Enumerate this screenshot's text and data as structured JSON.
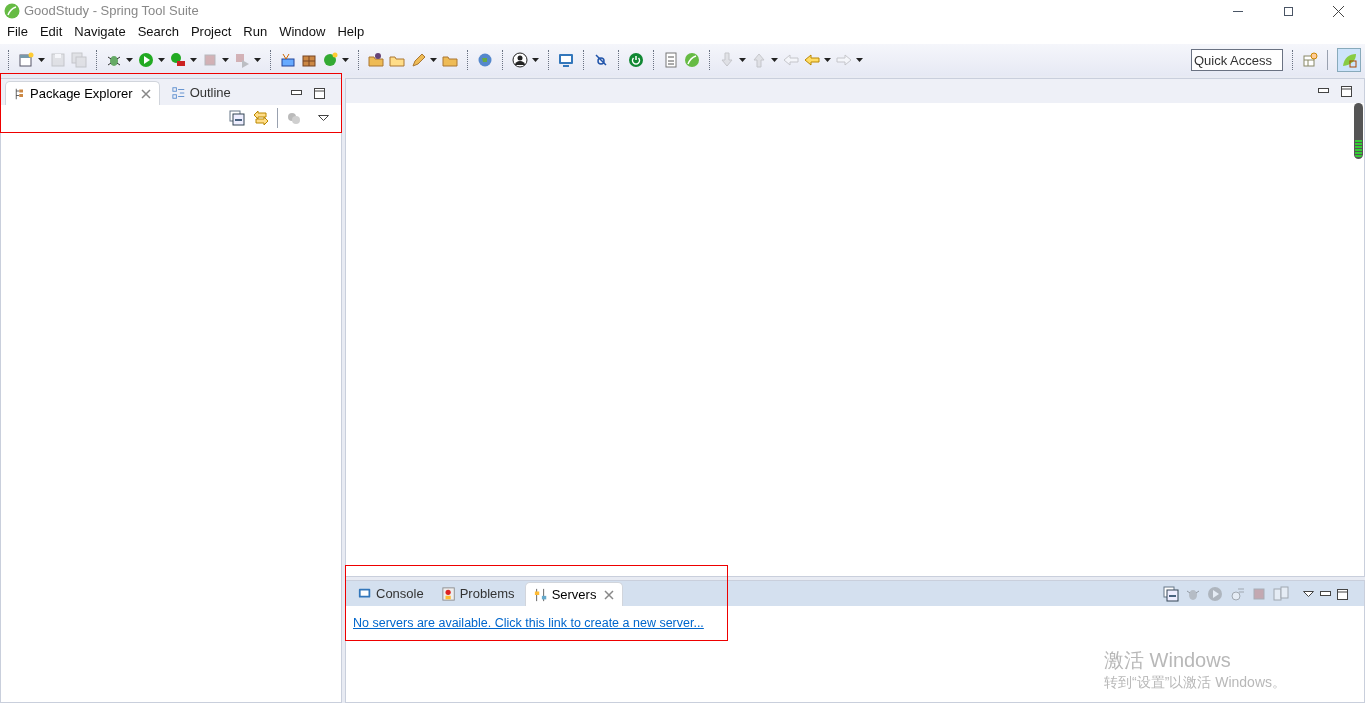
{
  "window": {
    "title": "GoodStudy - Spring Tool Suite"
  },
  "menu": [
    "File",
    "Edit",
    "Navigate",
    "Search",
    "Project",
    "Run",
    "Window",
    "Help"
  ],
  "quick_access": {
    "placeholder": "Quick Access"
  },
  "left_panel": {
    "tabs": [
      {
        "label": "Package Explorer",
        "selected": true
      },
      {
        "label": "Outline",
        "selected": false
      }
    ]
  },
  "bottom_panel": {
    "tabs": [
      {
        "label": "Console",
        "selected": false
      },
      {
        "label": "Problems",
        "selected": false
      },
      {
        "label": "Servers",
        "selected": true
      }
    ],
    "link": "No servers are available. Click this link to create a new server..."
  },
  "activation_notice": {
    "title": "激活 Windows",
    "message": "转到“设置”以激活 Windows。"
  }
}
